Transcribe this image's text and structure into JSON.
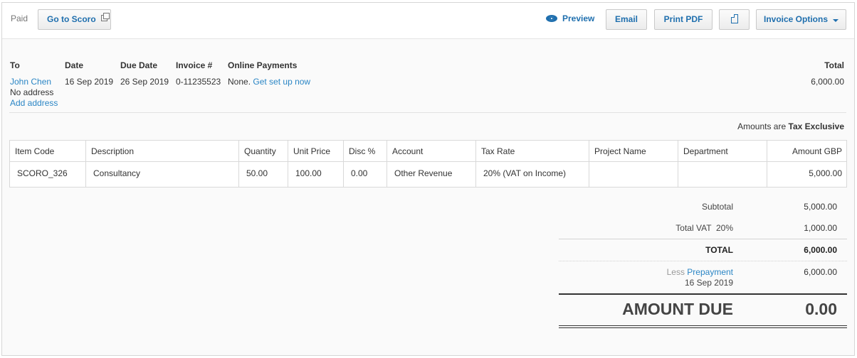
{
  "toolbar": {
    "status": "Paid",
    "goto_label": "Go to Scoro",
    "preview_label": "Preview",
    "email_label": "Email",
    "print_label": "Print PDF",
    "options_label": "Invoice Options"
  },
  "invoice": {
    "labels": {
      "to": "To",
      "date": "Date",
      "due_date": "Due Date",
      "invoice_no": "Invoice #",
      "online_payments": "Online Payments",
      "total": "Total"
    },
    "to_name": "John Chen",
    "no_address": "No address",
    "add_address": "Add address",
    "date": "16 Sep 2019",
    "due_date": "26 Sep 2019",
    "invoice_no": "0-11235523",
    "online_payments_none": "None.",
    "online_payments_link": "Get set up now",
    "total": "6,000.00"
  },
  "amounts_note": {
    "prefix": "Amounts are",
    "mode": "Tax Exclusive"
  },
  "table": {
    "columns": [
      "Item Code",
      "Description",
      "Quantity",
      "Unit Price",
      "Disc %",
      "Account",
      "Tax Rate",
      "Project Name",
      "Department",
      "Amount GBP"
    ],
    "rows": [
      [
        "SCORO_326",
        "Consultancy",
        "50.00",
        "100.00",
        "0.00",
        "Other Revenue",
        "20% (VAT on Income)",
        "",
        "",
        "5,000.00"
      ]
    ]
  },
  "totals": {
    "subtotal_label": "Subtotal",
    "subtotal": "5,000.00",
    "vat_label": "Total VAT  20%",
    "vat": "1,000.00",
    "total_label": "TOTAL",
    "total": "6,000.00",
    "less_label": "Less",
    "prepayment_link": "Prepayment",
    "prepayment_date": "16 Sep 2019",
    "prepayment": "6,000.00",
    "amount_due_label": "AMOUNT DUE",
    "amount_due": "0.00"
  },
  "colors": {
    "link": "#2b86c5",
    "button_text": "#1f6fae"
  }
}
